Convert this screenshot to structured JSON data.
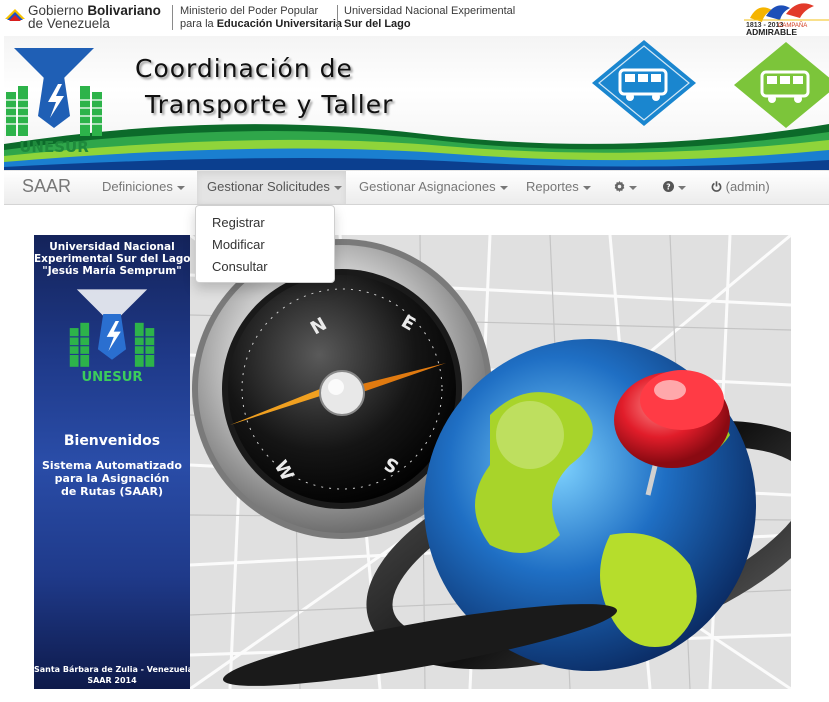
{
  "gov_header": {
    "gobierno_line1_prefix": "Gobierno",
    "gobierno_line1_bold": "Bolivariano",
    "gobierno_line2": "de Venezuela",
    "ministerio_line1": "Ministerio del Poder Popular",
    "ministerio_line2_prefix": "para la",
    "ministerio_line2_bold": "Educación Universitaria",
    "universidad_line1": "Universidad Nacional Experimental",
    "universidad_line2": "Sur del Lago",
    "campaign_years": "1813 - 2013",
    "campaign_word": "CAMPAÑA",
    "campaign_label": "ADMIRABLE"
  },
  "banner": {
    "title_line1": "Coordinación de",
    "title_line2": "Transporte y Taller",
    "logo_text": "UNESUR"
  },
  "navbar": {
    "brand": "SAAR",
    "items": [
      {
        "label": "Definiciones",
        "caret": true,
        "active": false
      },
      {
        "label": "Gestionar Solicitudes",
        "caret": true,
        "active": true
      },
      {
        "label": "Gestionar Asignaciones",
        "caret": true,
        "active": false
      },
      {
        "label": "Reportes",
        "caret": true,
        "active": false
      }
    ],
    "settings_icon": "gear-icon",
    "help_icon": "question-circle-icon",
    "power_icon": "power-icon",
    "user_label": "(admin)"
  },
  "dropdown": {
    "items": [
      "Registrar",
      "Modificar",
      "Consultar"
    ]
  },
  "left_panel": {
    "uni_line1": "Universidad Nacional",
    "uni_line2": "Experimental Sur del Lago",
    "uni_line3": "\"Jesús María Semprum\"",
    "logo_text": "UNESUR",
    "welcome": "Bienvenidos",
    "system_line1": "Sistema Automatizado",
    "system_line2": "para la Asignación",
    "system_line3": "de Rutas (SAAR)",
    "footer_line1": "Santa Bárbara de Zulia - Venezuela",
    "footer_line2": "SAAR 2014"
  },
  "compass": {
    "n": "N",
    "e": "E",
    "s": "S",
    "w": "W"
  },
  "colors": {
    "navbar_text": "#777777",
    "panel_blue": "#1f3a8a",
    "logo_green": "#2db34a",
    "pin_red": "#e11d2a"
  }
}
